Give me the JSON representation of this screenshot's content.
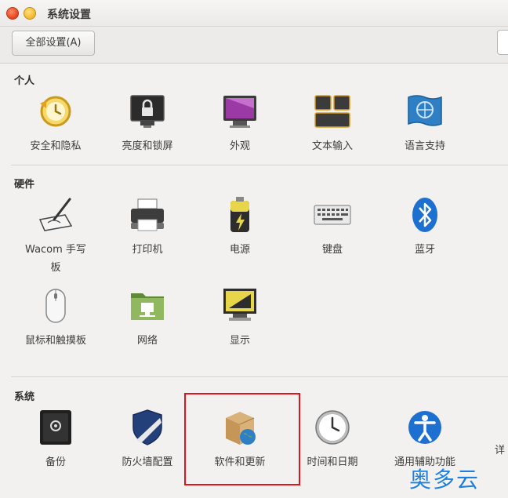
{
  "window": {
    "title": "系统设置"
  },
  "toolbar": {
    "all_settings": "全部设置(A)"
  },
  "sections": {
    "personal": {
      "label": "个人",
      "items": [
        {
          "label": "安全和隐私",
          "icon": "security-privacy-icon"
        },
        {
          "label": "亮度和锁屏",
          "icon": "brightness-lock-icon"
        },
        {
          "label": "外观",
          "icon": "appearance-icon"
        },
        {
          "label": "文本输入",
          "icon": "text-entry-icon"
        },
        {
          "label": "语言支持",
          "icon": "language-support-icon"
        }
      ]
    },
    "hardware": {
      "label": "硬件",
      "items": [
        {
          "label": "Wacom 手写板",
          "icon": "wacom-tablet-icon"
        },
        {
          "label": "打印机",
          "icon": "printer-icon"
        },
        {
          "label": "电源",
          "icon": "power-icon"
        },
        {
          "label": "键盘",
          "icon": "keyboard-icon"
        },
        {
          "label": "蓝牙",
          "icon": "bluetooth-icon"
        },
        {
          "label": "鼠标和触摸板",
          "icon": "mouse-touchpad-icon"
        },
        {
          "label": "网络",
          "icon": "network-icon"
        },
        {
          "label": "显示",
          "icon": "display-icon"
        }
      ]
    },
    "system": {
      "label": "系统",
      "items": [
        {
          "label": "备份",
          "icon": "backup-icon"
        },
        {
          "label": "防火墙配置",
          "icon": "firewall-icon"
        },
        {
          "label": "软件和更新",
          "icon": "software-updates-icon"
        },
        {
          "label": "时间和日期",
          "icon": "time-date-icon"
        },
        {
          "label": "通用辅助功能",
          "icon": "universal-access-icon"
        },
        {
          "label": "详",
          "icon": "details-icon"
        }
      ]
    }
  },
  "watermark": "奥多云",
  "colors": {
    "highlight": "#e0141a",
    "watermark": "#1e7fe0",
    "bluetooth": "#1d6fd0"
  }
}
